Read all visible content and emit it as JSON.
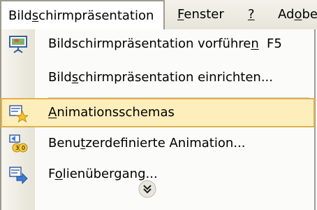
{
  "menubar": {
    "items": [
      {
        "pre": "Bild",
        "u": "s",
        "post": "chirmpräsentation"
      },
      {
        "pre": "",
        "u": "F",
        "post": "enster"
      },
      {
        "pre": "",
        "u": "?",
        "post": ""
      },
      {
        "pre": "Ad",
        "u": "o",
        "post": "be"
      }
    ]
  },
  "menu": {
    "items": [
      {
        "pre": "Bildschirmpräsentation vorführe",
        "u": "n",
        "post": "",
        "shortcut": "F5",
        "icon": "presentation-screen-icon"
      },
      {
        "pre": "Bild",
        "u": "s",
        "post": "chirmpräsentation einrichten...",
        "shortcut": "",
        "icon": ""
      },
      {
        "pre": "",
        "u": "A",
        "post": "nimationsschemas",
        "shortcut": "",
        "icon": "animation-schemes-star-icon"
      },
      {
        "pre": "Benu",
        "u": "t",
        "post": "zerdefinierte Animation...",
        "shortcut": "",
        "icon": "custom-animation-icon"
      },
      {
        "pre": "F",
        "u": "o",
        "post": "lienübergang...",
        "shortcut": "",
        "icon": "slide-transition-icon"
      }
    ],
    "expand_icon": "expand-chevrons-icon"
  },
  "colors": {
    "highlight_bg": "#fdeebc",
    "highlight_border": "#e0b24b",
    "menubar_bg": "#ece9d8"
  }
}
